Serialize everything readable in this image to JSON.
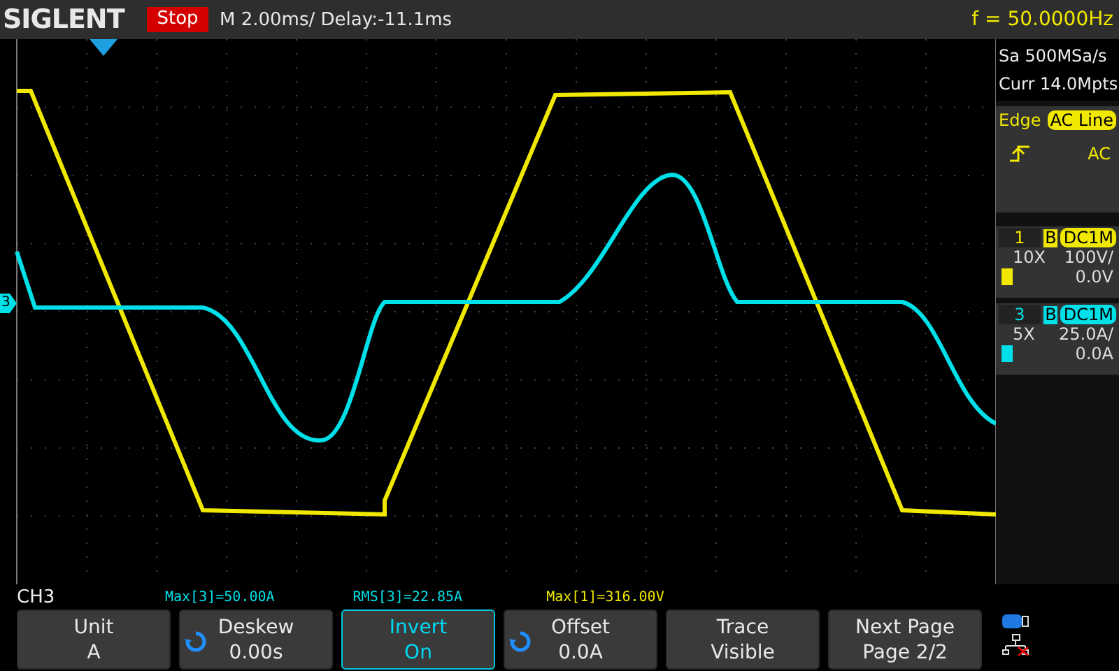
{
  "top_bar": {
    "logo": "SIGLENT",
    "run_state": "Stop",
    "timebase": "M 2.00ms/ Delay:-11.1ms",
    "frequency": "f = 50.0000Hz"
  },
  "acquisition": {
    "sample_rate": "Sa 500MSa/s",
    "memory": "Curr 14.0Mpts"
  },
  "trigger": {
    "type": "Edge",
    "source": "AC Line",
    "coupling": "AC"
  },
  "channels": [
    {
      "number": "1",
      "bandwidth": "B",
      "coupling": "DC1M",
      "probe": "10X",
      "scale": "100V/",
      "offset": "0.0V",
      "color": "#f0e800"
    },
    {
      "number": "3",
      "bandwidth": "B",
      "coupling": "DC1M",
      "probe": "5X",
      "scale": "25.0A/",
      "offset": "0.0A",
      "color": "#00e0e8"
    }
  ],
  "channel_marker": {
    "label": "3",
    "color": "#00e0e8"
  },
  "menu_title": "CH3",
  "measurements": [
    {
      "text": "Max[3]=50.00A",
      "color": "#00e0e8"
    },
    {
      "text": "RMS[3]=22.85A",
      "color": "#00e0e8"
    },
    {
      "text": "Max[1]=316.00V",
      "color": "#f0e800"
    }
  ],
  "softkeys": [
    {
      "title": "Unit",
      "value": "A",
      "knob": false,
      "selected": false
    },
    {
      "title": "Deskew",
      "value": "0.00s",
      "knob": true,
      "selected": false
    },
    {
      "title": "Invert",
      "value": "On",
      "knob": false,
      "selected": true
    },
    {
      "title": "Offset",
      "value": "0.0A",
      "knob": true,
      "selected": false
    },
    {
      "title": "Trace",
      "value": "Visible",
      "knob": false,
      "selected": false
    },
    {
      "title": "Next Page",
      "value": "Page 2/2",
      "knob": false,
      "selected": false
    }
  ]
}
